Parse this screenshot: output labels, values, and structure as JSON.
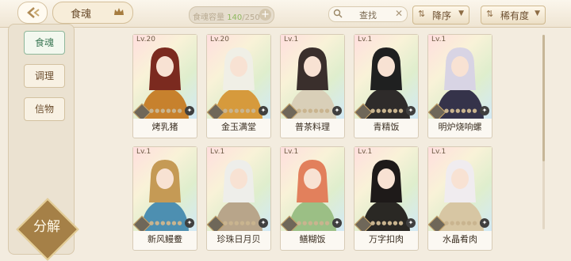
{
  "header": {
    "title": "食魂",
    "capacity_label": "食魂容量",
    "capacity_current": "140",
    "capacity_max": "/250",
    "search_text": "查找",
    "sort_order": "降序",
    "sort_by": "稀有度"
  },
  "sidebar": {
    "items": [
      {
        "label": "食魂"
      },
      {
        "label": "调理"
      },
      {
        "label": "信物"
      }
    ],
    "decompose_label": "分解"
  },
  "cards": [
    {
      "level": "Lv.20",
      "name": "烤乳猪",
      "hair": "#7b2a1f",
      "robe": "#c7812d"
    },
    {
      "level": "Lv.20",
      "name": "金玉满堂",
      "hair": "#f0efe6",
      "robe": "#d69a3c"
    },
    {
      "level": "Lv.1",
      "name": "普茶料理",
      "hair": "#3a2f2c",
      "robe": "#d9cfb8"
    },
    {
      "level": "Lv.1",
      "name": "青精饭",
      "hair": "#1f2020",
      "robe": "#2e2b2a"
    },
    {
      "level": "Lv.1",
      "name": "明炉烧响螺",
      "hair": "#d8d4e4",
      "robe": "#35334a"
    },
    {
      "level": "Lv.1",
      "name": "新风鳗鲞",
      "hair": "#c59a55",
      "robe": "#4d8fb1"
    },
    {
      "level": "Lv.1",
      "name": "珍珠日月贝",
      "hair": "#eeeeea",
      "robe": "#b8a58a"
    },
    {
      "level": "Lv.1",
      "name": "鳝糊饭",
      "hair": "#e2805c",
      "robe": "#9bbf85"
    },
    {
      "level": "Lv.1",
      "name": "万字扣肉",
      "hair": "#1e1a19",
      "robe": "#2a2824"
    },
    {
      "level": "Lv.1",
      "name": "水晶肴肉",
      "hair": "#f0ecef",
      "robe": "#d7c6a3"
    }
  ],
  "colors": {
    "accent_green": "#8fb85f",
    "brand_brown": "#6b4d2d",
    "background": "#f3ecdf"
  }
}
